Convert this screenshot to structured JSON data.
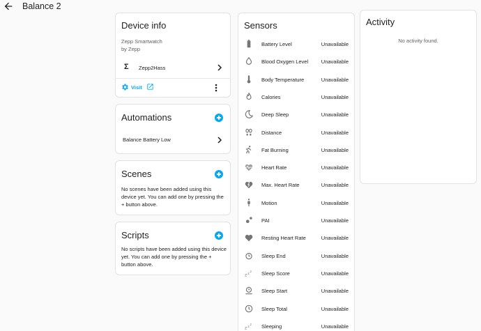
{
  "header": {
    "title": "Balance 2"
  },
  "device_info": {
    "title": "Device info",
    "model": "Zepp Smartwatch",
    "manufacturer": "by Zepp",
    "integration": "Zepp2Hass",
    "visit_label": "Visit"
  },
  "automations": {
    "title": "Automations",
    "items": [
      "Balance Battery Low"
    ]
  },
  "scenes": {
    "title": "Scenes",
    "empty_text": "No scenes have been added using this device yet. You can add one by pressing the + button above."
  },
  "scripts": {
    "title": "Scripts",
    "empty_text": "No scripts have been added using this device yet. You can add one by pressing the + button above."
  },
  "sensors": {
    "title": "Sensors",
    "items": [
      {
        "name": "Battery Level",
        "value": "Unavailable",
        "icon": "battery-icon"
      },
      {
        "name": "Blood Oxygen Level",
        "value": "Unavailable",
        "icon": "water-drop-icon"
      },
      {
        "name": "Body Temperature",
        "value": "Unavailable",
        "icon": "thermometer-icon"
      },
      {
        "name": "Calories",
        "value": "Unavailable",
        "icon": "fire-icon"
      },
      {
        "name": "Deep Sleep",
        "value": "Unavailable",
        "icon": "moon-icon"
      },
      {
        "name": "Distance",
        "value": "Unavailable",
        "icon": "footprints-icon"
      },
      {
        "name": "Fat Burning",
        "value": "Unavailable",
        "icon": "running-icon"
      },
      {
        "name": "Heart Rate",
        "value": "Unavailable",
        "icon": "heart-pulse-icon"
      },
      {
        "name": "Max. Heart Rate",
        "value": "Unavailable",
        "icon": "heart-flash-icon"
      },
      {
        "name": "Motion",
        "value": "Unavailable",
        "icon": "person-icon"
      },
      {
        "name": "PAI",
        "value": "Unavailable",
        "icon": "molecule-icon"
      },
      {
        "name": "Resting Heart Rate",
        "value": "Unavailable",
        "icon": "heart-icon"
      },
      {
        "name": "Sleep End",
        "value": "Unavailable",
        "icon": "alarm-clock-icon"
      },
      {
        "name": "Sleep Score",
        "value": "Unavailable",
        "icon": "sleep-zzz-icon"
      },
      {
        "name": "Sleep Start",
        "value": "Unavailable",
        "icon": "bed-clock-icon"
      },
      {
        "name": "Sleep Total",
        "value": "Unavailable",
        "icon": "clock-icon"
      },
      {
        "name": "Sleeping",
        "value": "Unavailable",
        "icon": "sleep-zzz-icon"
      }
    ]
  },
  "activity": {
    "title": "Activity",
    "empty_text": "No activity found."
  },
  "colors": {
    "accent": "#03a9f4",
    "icon": "#757575",
    "border": "#e2e2e2"
  }
}
